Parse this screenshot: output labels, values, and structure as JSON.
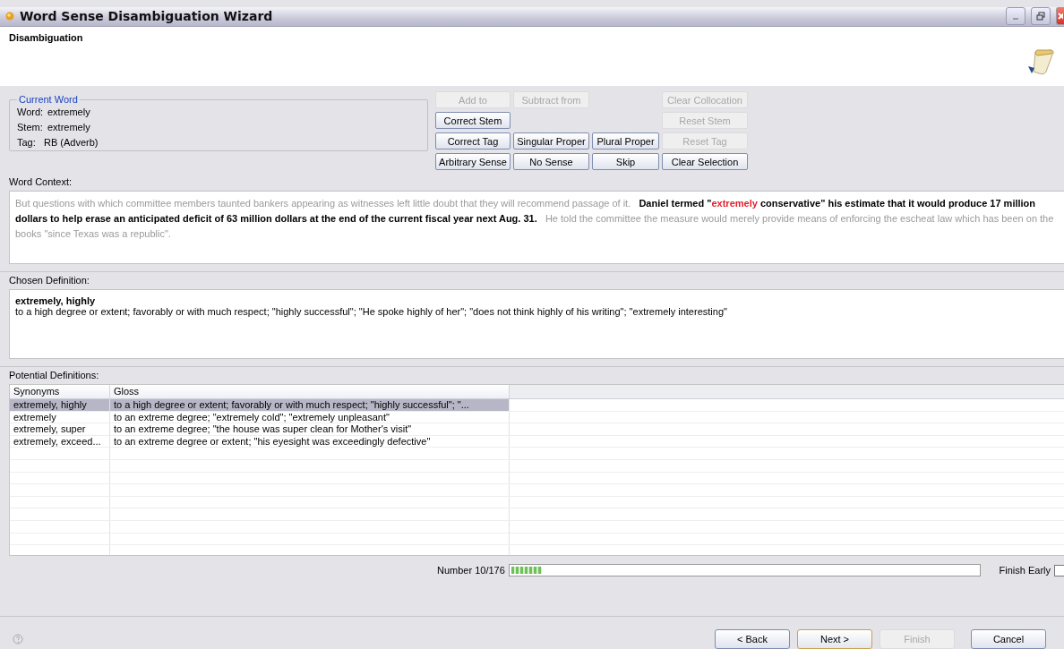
{
  "window": {
    "title": "Word Sense Disambiguation Wizard"
  },
  "header": {
    "title": "Disambiguation"
  },
  "current_word": {
    "legend": "Current Word",
    "fields": [
      {
        "label": "Word:",
        "value": "extremely"
      },
      {
        "label": "Stem:",
        "value": "extremely"
      },
      {
        "label": "Tag:",
        "value": "RB (Adverb)"
      }
    ]
  },
  "button_rows": [
    [
      {
        "kind": "button",
        "label": "Add to",
        "disabled": true
      },
      {
        "kind": "button",
        "label": "Subtract from",
        "disabled": true
      },
      {
        "kind": "gap"
      },
      {
        "kind": "button",
        "label": "Clear Collocation",
        "disabled": true
      }
    ],
    [
      {
        "kind": "button",
        "label": "Correct Stem",
        "disabled": false
      },
      {
        "kind": "gap"
      },
      {
        "kind": "gap"
      },
      {
        "kind": "button",
        "label": "Reset Stem",
        "disabled": true
      }
    ],
    [
      {
        "kind": "button",
        "label": "Correct Tag",
        "disabled": false
      },
      {
        "kind": "button",
        "label": "Singular Proper",
        "disabled": false
      },
      {
        "kind": "button",
        "label": "Plural Proper",
        "disabled": false
      },
      {
        "kind": "button",
        "label": "Reset Tag",
        "disabled": true
      }
    ],
    [
      {
        "kind": "button",
        "label": "Arbitrary Sense",
        "disabled": false
      },
      {
        "kind": "button",
        "label": "No Sense",
        "disabled": false
      },
      {
        "kind": "button",
        "label": "Skip",
        "disabled": false
      },
      {
        "kind": "button",
        "label": "Clear Selection",
        "disabled": false
      }
    ]
  ],
  "word_context": {
    "label": "Word Context:",
    "segments": [
      {
        "kind": "dim",
        "text": "But questions with which committee members taunted bankers appearing as witnesses left little doubt that they will recommend passage of it."
      },
      {
        "kind": "focus",
        "text": "Daniel termed \""
      },
      {
        "kind": "word",
        "text": "extremely"
      },
      {
        "kind": "focus",
        "text": " conservative\" his estimate that it would produce 17 million dollars to help erase an anticipated deficit of 63 million dollars at the end of the current fiscal year next Aug. 31."
      },
      {
        "kind": "dim",
        "text": "He told the committee the measure would merely provide means of enforcing the escheat law which has been on the books \"since Texas was a republic\"."
      }
    ]
  },
  "chosen_definition": {
    "label": "Chosen Definition:",
    "synonyms": "extremely, highly",
    "gloss": "to a high degree or extent; favorably or with much respect; \"highly successful\"; \"He spoke highly of her\"; \"does not think highly of his writing\"; \"extremely interesting\""
  },
  "potential_definitions": {
    "label": "Potential Definitions:",
    "columns": [
      "Synonyms",
      "Gloss"
    ],
    "rows": [
      {
        "synonyms": "extremely, highly",
        "gloss": "to a high degree or extent; favorably or with much respect; \"highly successful\"; \"...",
        "selected": true
      },
      {
        "synonyms": "extremely",
        "gloss": "to an extreme degree; \"extremely cold\"; \"extremely unpleasant\"",
        "selected": false
      },
      {
        "synonyms": "extremely, super",
        "gloss": "to an extreme degree; \"the house was super clean for Mother's visit\"",
        "selected": false
      },
      {
        "synonyms": "extremely, exceed...",
        "gloss": "to an extreme degree or extent; \"his eyesight was exceedingly defective\"",
        "selected": false
      }
    ]
  },
  "progress": {
    "label": "Number 10/176",
    "level": 0.065
  },
  "finish_early": {
    "label": "Finish Early",
    "checked": false
  },
  "footer_buttons": [
    {
      "label": "< Back",
      "disabled": false,
      "default": false
    },
    {
      "label": "Next >",
      "disabled": false,
      "default": true
    },
    {
      "label": "Finish",
      "disabled": true,
      "default": false
    },
    {
      "label": "Cancel",
      "disabled": false,
      "default": false
    }
  ]
}
